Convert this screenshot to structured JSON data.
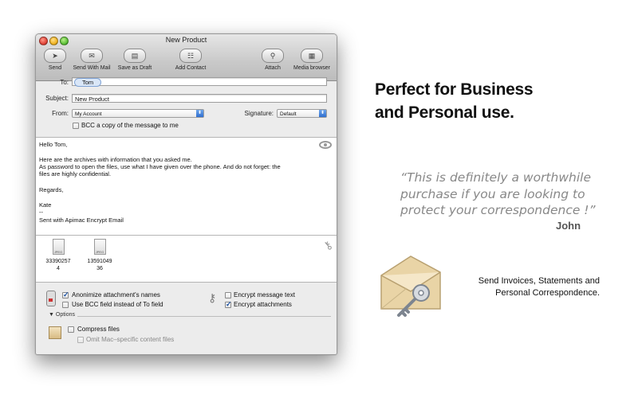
{
  "window": {
    "title": "New Product",
    "toolbar": [
      {
        "label": "Send",
        "icon": "send-icon"
      },
      {
        "label": "Send With Mail",
        "icon": "mail-icon"
      },
      {
        "label": "Save as Draft",
        "icon": "draft-icon"
      },
      {
        "label": "Add Contact",
        "icon": "address-book-icon"
      },
      {
        "label": "Attach",
        "icon": "paperclip-icon"
      },
      {
        "label": "Media browser",
        "icon": "media-browser-icon"
      }
    ]
  },
  "header": {
    "to_label": "To:",
    "to_token": "Tom",
    "subject_label": "Subject:",
    "subject_value": "New Product",
    "from_label": "From:",
    "from_value": "My Account",
    "signature_label": "Signature:",
    "signature_value": "Default",
    "bcc_copy_label": "BCC a copy of the message to me"
  },
  "message_body": {
    "lines": [
      "Hello Tom,",
      "",
      "Here are the archives with information that you asked me.",
      "As password to open the files, use what I have given over the phone. And do not forget: the",
      "files are highly confidential.",
      "",
      "Regards,",
      "",
      "Kate",
      "--",
      "Sent with Apimac Encrypt Email"
    ]
  },
  "attachments": [
    {
      "name_line1": "33390257",
      "name_line2": "4",
      "type": "JPEG"
    },
    {
      "name_line1": "13591049",
      "name_line2": "36",
      "type": "JPEG"
    }
  ],
  "options": {
    "anonimize_label": "Anonimize attachment's names",
    "anonimize_checked": true,
    "bcc_field_label": "Use BCC field instead of To field",
    "bcc_field_checked": false,
    "encrypt_text_label": "Encrypt message text",
    "encrypt_text_checked": false,
    "encrypt_attachments_label": "Encrypt attachments",
    "encrypt_attachments_checked": true,
    "options_toggle_label": "Options",
    "compress_label": "Compress files",
    "compress_checked": false,
    "omit_mac_label": "Omit Mac–specific content files",
    "omit_mac_checked": false
  },
  "marketing": {
    "headline_line1": "Perfect for Business",
    "headline_line2": "and Personal use.",
    "quote_line1": "“This is definitely a worthwhile",
    "quote_line2": "purchase if you are looking to",
    "quote_line3": "protect your correspondence !”",
    "quote_author": "John",
    "tagline_line1": "Send Invoices, Statements and",
    "tagline_line2": "Personal Correspondence."
  }
}
